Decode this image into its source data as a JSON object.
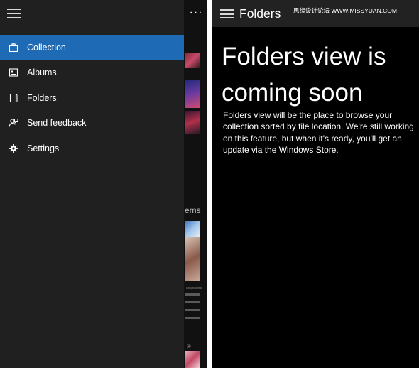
{
  "left_screen": {
    "more_label": "···",
    "background_fragment": "ems",
    "tiny_text": "ssspecies",
    "registered_mark": "®",
    "menu": [
      {
        "label": "Collection",
        "icon": "collection-icon",
        "active": true
      },
      {
        "label": "Albums",
        "icon": "albums-icon",
        "active": false
      },
      {
        "label": "Folders",
        "icon": "folders-icon",
        "active": false
      },
      {
        "label": "Send feedback",
        "icon": "feedback-icon",
        "active": false
      },
      {
        "label": "Settings",
        "icon": "gear-icon",
        "active": false
      }
    ],
    "colors": {
      "pane_bg": "#202020",
      "active_bg": "#1e6ab5"
    }
  },
  "right_screen": {
    "title": "Folders",
    "watermark": "思缘设计论坛 WWW.MISSYUAN.COM",
    "heading": "Folders view is coming soon",
    "body": "Folders view will be the place to browse your collection sorted by file location. We're still working on this feature, but when it's ready, you'll get an update via the Windows Store."
  }
}
